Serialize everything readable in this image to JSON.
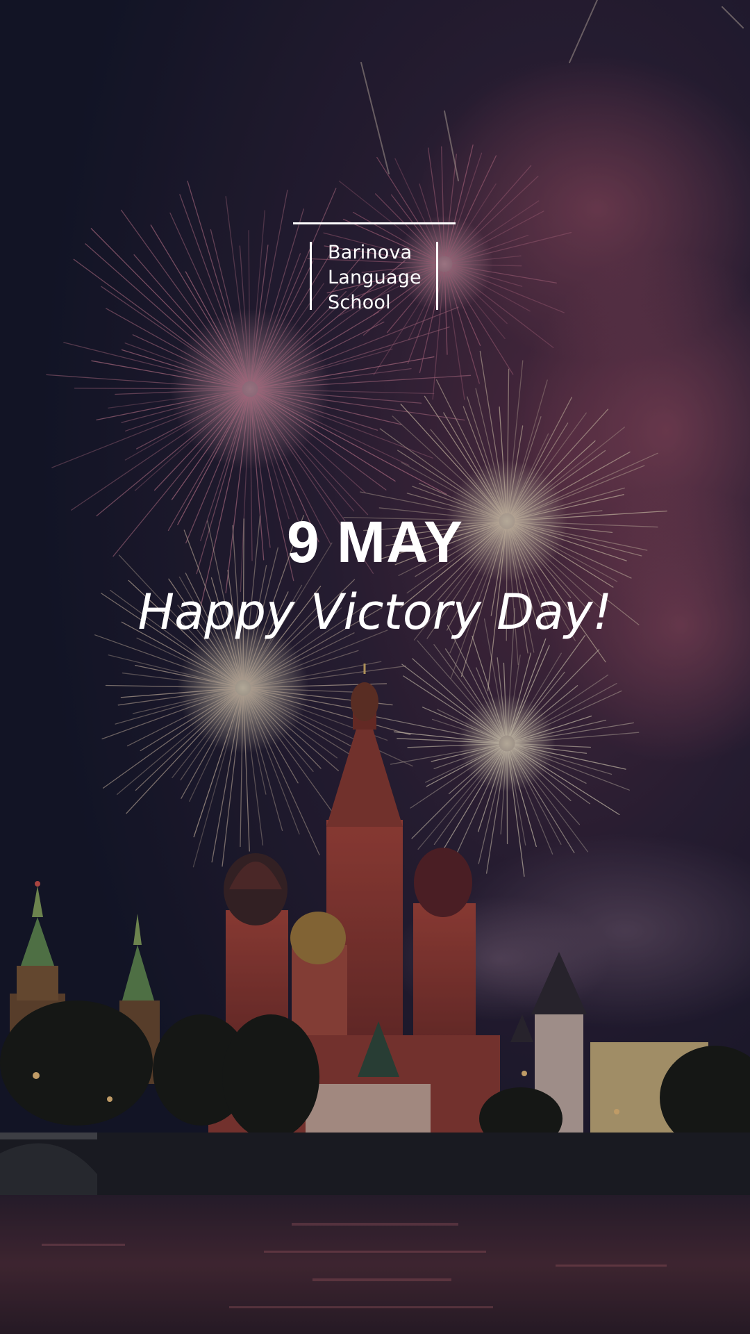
{
  "logo": {
    "line1": "Barinova",
    "line2": "Language",
    "line3": "School"
  },
  "headline": {
    "date": "9 MAY",
    "greeting": "Happy Victory Day!"
  },
  "colors": {
    "text": "#ffffff",
    "sky": "#141829",
    "firework_pink": "#c77a92",
    "firework_gold": "#e7d2b8",
    "cathedral_red": "#9c3b32",
    "tower_green": "#5f8a4f"
  }
}
